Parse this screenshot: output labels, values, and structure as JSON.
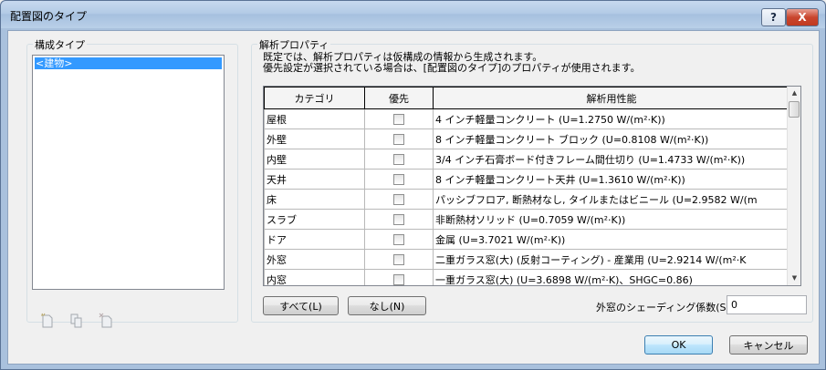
{
  "window": {
    "title": "配置図のタイプ",
    "help_label": "?",
    "close_label": "X"
  },
  "left_panel": {
    "group_label": "構成タイプ",
    "list_items": [
      "<建物>"
    ]
  },
  "right_panel": {
    "group_label": "解析プロパティ",
    "description_line1": "既定では、解析プロパティは仮構成の情報から生成されます。",
    "description_line2": "優先設定が選択されている場合は、[配置図のタイプ]のプロパティが使用されます。",
    "table": {
      "headers": [
        "カテゴリ",
        "優先",
        "解析用性能"
      ],
      "rows": [
        {
          "category": "屋根",
          "override": false,
          "property": "4 インチ軽量コンクリート (U=1.2750 W/(m²·K))"
        },
        {
          "category": "外壁",
          "override": false,
          "property": "8 インチ軽量コンクリート ブロック (U=0.8108 W/(m²·K))"
        },
        {
          "category": "内壁",
          "override": false,
          "property": "3/4 インチ石膏ボード付きフレーム間仕切り (U=1.4733 W/(m²·K))"
        },
        {
          "category": "天井",
          "override": false,
          "property": "8 インチ軽量コンクリート天井 (U=1.3610 W/(m²·K))"
        },
        {
          "category": "床",
          "override": false,
          "property": "パッシブフロア, 断熱材なし, タイルまたはビニール (U=2.9582 W/(m"
        },
        {
          "category": "スラブ",
          "override": false,
          "property": "非断熱材ソリッド (U=0.7059 W/(m²·K))"
        },
        {
          "category": "ドア",
          "override": false,
          "property": "金属 (U=3.7021 W/(m²·K))"
        },
        {
          "category": "外窓",
          "override": false,
          "property": "二重ガラス窓(大) (反射コーティング) - 産業用 (U=2.9214 W/(m²·K"
        },
        {
          "category": "内窓",
          "override": false,
          "property": "一重ガラス窓(大) (U=3.6898 W/(m²·K)、SHGC=0.86)"
        }
      ]
    },
    "all_button": "すべて(L)",
    "none_button": "なし(N)",
    "shading_label": "外窓のシェーディング係数(S):",
    "shading_value": "0"
  },
  "footer": {
    "ok_label": "OK",
    "cancel_label": "キャンセル"
  },
  "icons": [
    "new-type-icon",
    "duplicate-type-icon",
    "delete-type-icon"
  ]
}
